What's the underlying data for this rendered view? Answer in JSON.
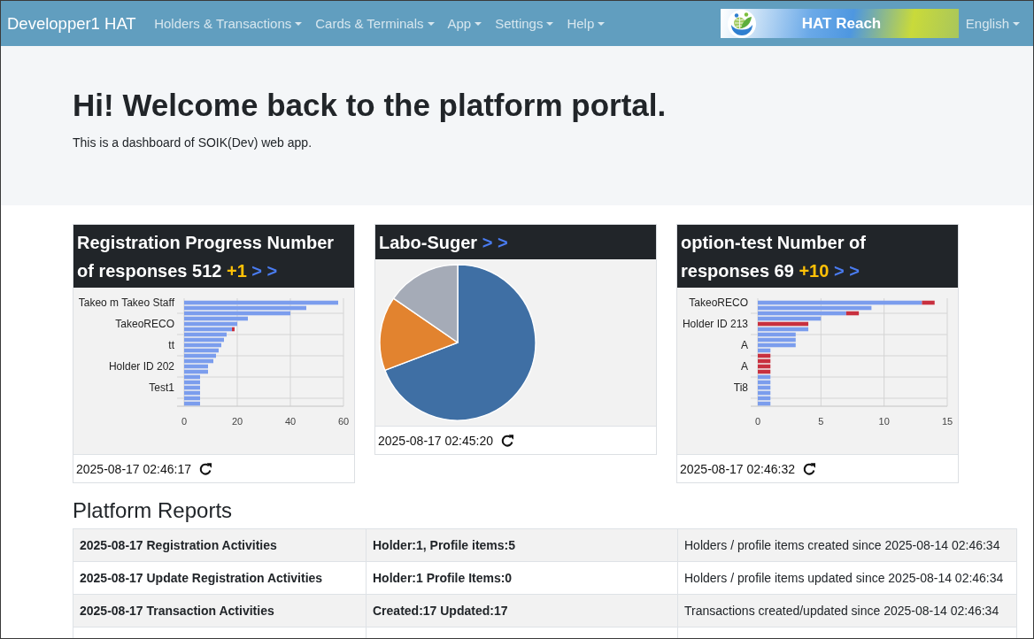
{
  "navbar": {
    "brand": "Developper1 HAT",
    "menus": [
      "Holders & Transactions",
      "Cards & Terminals",
      "App",
      "Settings",
      "Help"
    ],
    "logo": {
      "text": "HAT Reach"
    },
    "language": "English"
  },
  "hero": {
    "title": "Hi! Welcome back to the platform portal.",
    "subtitle": "This is a dashboard of SOIK(Dev) web app."
  },
  "cards": [
    {
      "title": "Registration Progress Number of responses 512",
      "delta": "+1",
      "link": "> >",
      "chart_data": {
        "type": "bar",
        "orientation": "horizontal",
        "stacked": true,
        "grid": true,
        "categories": [
          "Takeo m Takeo Staff",
          null,
          null,
          null,
          "TakeoRECO",
          null,
          null,
          null,
          "tt",
          null,
          null,
          null,
          "Holder ID 202",
          null,
          null,
          null,
          "Test1",
          null,
          null,
          null
        ],
        "xlim": [
          0,
          60
        ],
        "xticks": [
          0,
          20,
          40,
          60
        ],
        "series": [
          {
            "color": "#7b9ded",
            "values": [
              58,
              46,
              40,
              24,
              20,
              18,
              16,
              15,
              14,
              13,
              12,
              11,
              9,
              9,
              6,
              6,
              6,
              6,
              6,
              6
            ]
          },
          {
            "color": "#c8303f",
            "values": [
              0,
              0,
              0,
              0,
              0,
              1,
              0,
              0,
              0,
              0,
              0,
              0,
              0,
              0,
              0,
              0,
              0,
              0,
              0,
              0
            ]
          }
        ]
      },
      "updated": "2025-08-17 02:46:17"
    },
    {
      "title": "Labo-Suger",
      "link": "> >",
      "chart_data": {
        "type": "pie",
        "values": [
          69.2,
          15.4,
          15.4
        ]
      },
      "updated": "2025-08-17 02:45:20"
    },
    {
      "title": "option-test Number of responses 69",
      "delta": "+10",
      "link": "> >",
      "chart_data": {
        "type": "bar",
        "orientation": "horizontal",
        "stacked": true,
        "grid": true,
        "categories": [
          "TakeoRECO",
          null,
          null,
          null,
          "Holder ID 213",
          null,
          null,
          null,
          "A",
          null,
          null,
          null,
          "A",
          null,
          null,
          null,
          "Ti8",
          null,
          null,
          null
        ],
        "xlim": [
          0,
          15
        ],
        "xticks": [
          0,
          5,
          10,
          15
        ],
        "series": [
          {
            "color": "#7b9ded",
            "values": [
              13,
              9,
              7,
              5,
              0,
              4,
              3,
              3,
              3,
              1,
              0,
              0,
              0,
              0,
              1,
              1,
              1,
              1,
              1,
              1
            ]
          },
          {
            "color": "#c8303f",
            "values": [
              1,
              0,
              1,
              0,
              4,
              0,
              0,
              0,
              0,
              0,
              1,
              1,
              1,
              1,
              0,
              0,
              0,
              0,
              0,
              0
            ]
          }
        ]
      },
      "updated": "2025-08-17 02:46:32"
    }
  ],
  "reports": {
    "title": "Platform Reports",
    "rows": [
      {
        "cells": [
          "2025-08-17 Registration Activities",
          "Holder:1, Profile items:5",
          "Holders / profile items created since 2025-08-14 02:46:34"
        ]
      },
      {
        "cells": [
          "2025-08-17 Update Registration Activities",
          "Holder:1 Profile Items:0",
          "Holders / profile items updated since 2025-08-14 02:46:34"
        ]
      },
      {
        "cells": [
          "2025-08-17 Transaction Activities",
          "Created:17 Updated:17",
          "Transactions created/updated since 2025-08-14 02:46:34"
        ]
      }
    ]
  }
}
